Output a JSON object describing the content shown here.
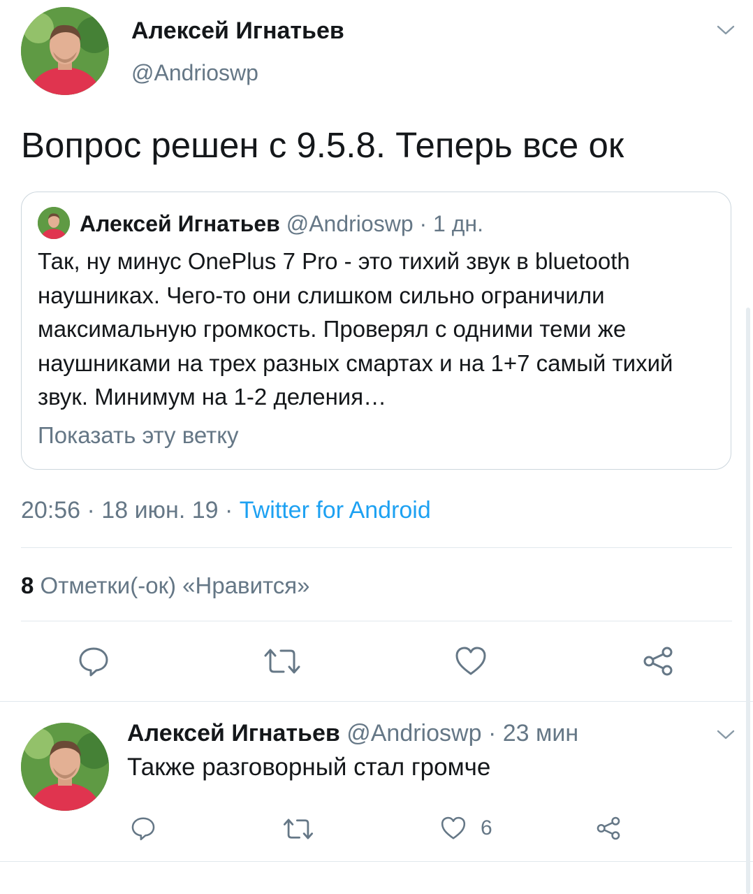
{
  "main_tweet": {
    "author_name": "Алексей Игнатьев",
    "author_handle": "@Andrioswp",
    "text": "Вопрос решен с 9.5.8. Теперь все ок",
    "quoted": {
      "author_name": "Алексей Игнатьев",
      "author_handle": "@Andrioswp",
      "time": "· 1 дн.",
      "text": "Так, ну минус OnePlus 7 Pro - это тихий звук в bluetooth наушниках. Чего-то они слишком сильно ограничили максимальную громкость. Проверял с одними теми же наушниками на трех разных смартах и на 1+7 самый тихий звук. Минимум на 1-2 деления…",
      "show_thread": "Показать эту ветку"
    },
    "timestamp": "20:56 · 18 июн. 19 ·",
    "client": "Twitter for Android",
    "likes_count": "8",
    "likes_label": "Отметки(-ок) «Нравится»"
  },
  "reply_tweet": {
    "author_name": "Алексей Игнатьев",
    "author_handle": "@Andrioswp",
    "time": "· 23 мин",
    "text": "Также разговорный стал громче",
    "like_count": "6"
  },
  "icons": [
    "chevron-down-icon",
    "reply-icon",
    "retweet-icon",
    "like-icon",
    "share-icon"
  ],
  "colors": {
    "accent": "#1da1f2",
    "muted": "#657786",
    "divider": "#e1e8ed",
    "avatar_shirt": "#e0344f"
  }
}
